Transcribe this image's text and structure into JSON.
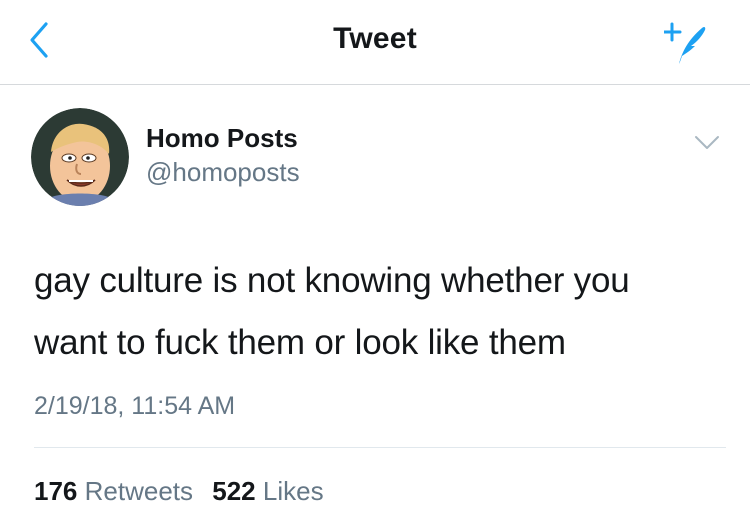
{
  "nav": {
    "title": "Tweet"
  },
  "tweet": {
    "author": {
      "name": "Homo Posts",
      "handle": "@homoposts"
    },
    "text_line1": "gay culture is not knowing whether you",
    "text_line2": "want to fuck them or look like them",
    "timestamp": "2/19/18, 11:54 AM",
    "stats": {
      "retweets_count": "176",
      "retweets_label": "Retweets",
      "likes_count": "522",
      "likes_label": "Likes"
    }
  },
  "icons": {
    "back": "chevron-left-icon",
    "compose": "compose-tweet-icon",
    "menu": "chevron-down-icon"
  },
  "colors": {
    "accent": "#1da1f2",
    "text_primary": "#14171a",
    "text_secondary": "#657786",
    "divider": "#e1e8ed"
  }
}
